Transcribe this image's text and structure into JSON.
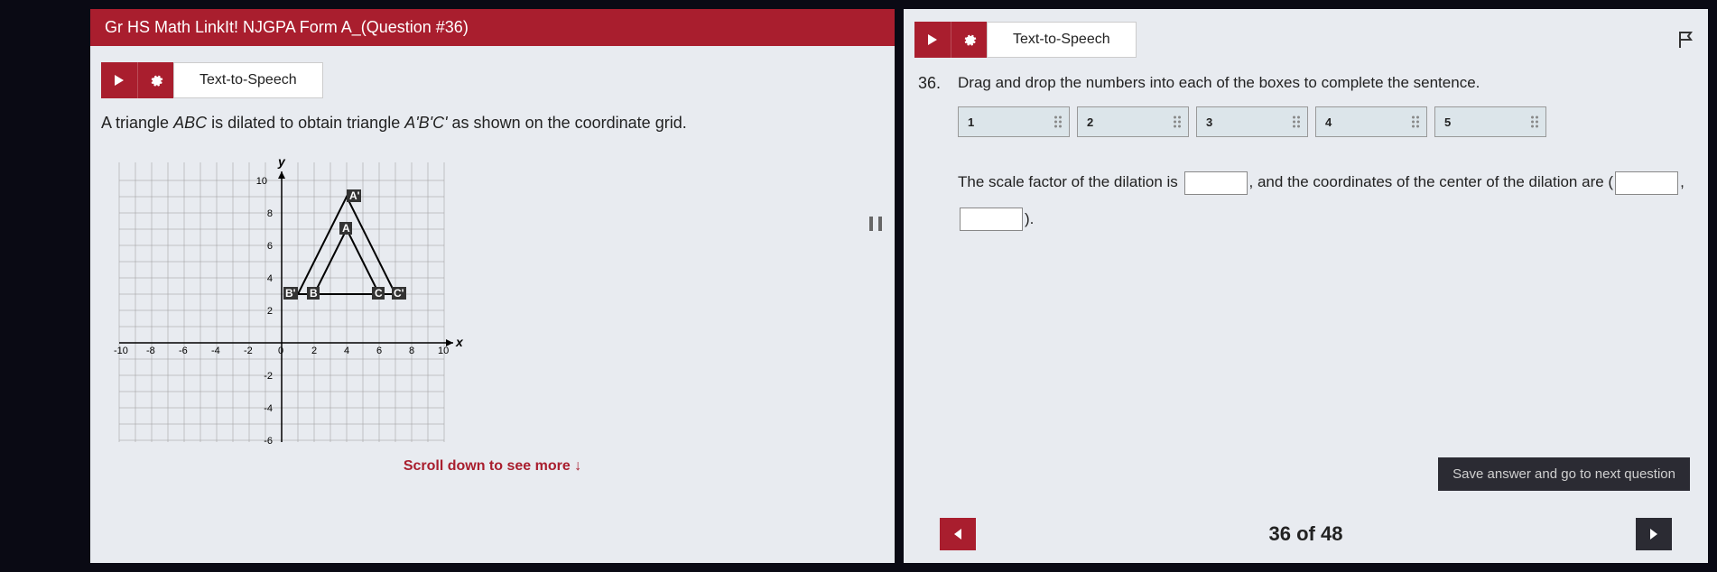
{
  "left": {
    "title": "Gr HS Math LinkIt! NJGPA Form A_(Question #36)",
    "tts_label": "Text-to-Speech",
    "question_prefix": "A triangle ",
    "question_tri1": "ABC",
    "question_mid": " is dilated to obtain triangle ",
    "question_tri2": "A'B'C'",
    "question_suffix": " as shown on the coordinate grid.",
    "scroll_hint": "Scroll down to see more   ↓"
  },
  "right": {
    "tts_label": "Text-to-Speech",
    "q_num": "36.",
    "instruction": "Drag and drop the numbers into each of the boxes to complete the sentence.",
    "tiles": [
      "1",
      "2",
      "3",
      "4",
      "5"
    ],
    "sentence_p1": "The scale factor of the dilation is ",
    "sentence_p2": ", and the coordinates of the center of the dilation are (",
    "sentence_comma": ", ",
    "sentence_end": ").",
    "save_label": "Save answer and go to next question",
    "progress": "36 of 48"
  },
  "chart_data": {
    "type": "scatter",
    "title": "",
    "xlabel": "x",
    "ylabel": "y",
    "xlim": [
      -10,
      10
    ],
    "ylim": [
      -6,
      10
    ],
    "xticks": [
      -10,
      -8,
      -6,
      -4,
      -2,
      0,
      2,
      4,
      6,
      8,
      10
    ],
    "yticks": [
      -6,
      -4,
      -2,
      2,
      4,
      6,
      8,
      10
    ],
    "series": [
      {
        "name": "ABC",
        "points": {
          "A": [
            4,
            7
          ],
          "B": [
            2,
            3
          ],
          "C": [
            6,
            3
          ]
        }
      },
      {
        "name": "A'B'C'",
        "points": {
          "A'": [
            4,
            9
          ],
          "B'": [
            1,
            3
          ],
          "C'": [
            7,
            3
          ]
        }
      }
    ]
  }
}
